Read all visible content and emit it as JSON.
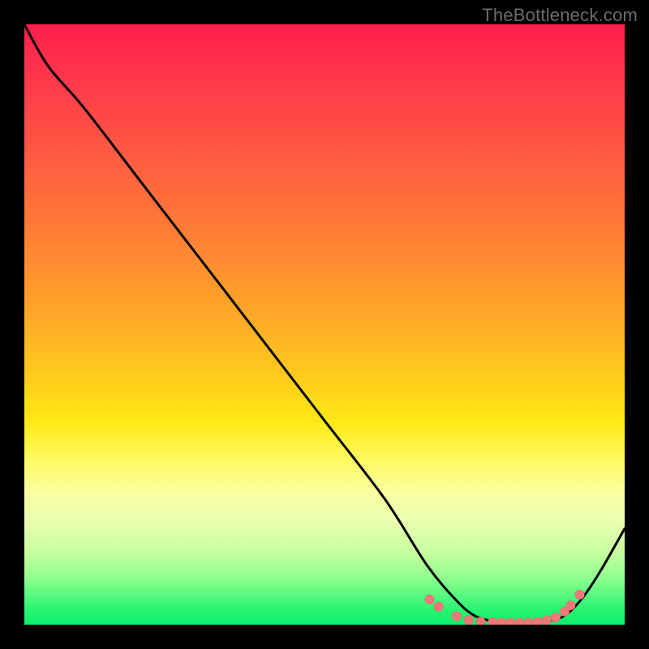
{
  "watermark": "TheBottleneck.com",
  "chart_data": {
    "type": "line",
    "title": "",
    "xlabel": "",
    "ylabel": "",
    "xlim": [
      0,
      100
    ],
    "ylim": [
      0,
      100
    ],
    "grid": false,
    "legend": false,
    "series": [
      {
        "name": "bottleneck-curve",
        "x": [
          0,
          4,
          10,
          20,
          30,
          40,
          50,
          60,
          67,
          72,
          75,
          78,
          81,
          84,
          87,
          90,
          93,
          96,
          100
        ],
        "y": [
          100,
          93,
          86,
          73,
          60,
          47,
          34,
          21,
          10,
          4,
          1.5,
          0.6,
          0.3,
          0.3,
          0.6,
          1.5,
          4.5,
          9,
          16
        ]
      }
    ],
    "highlight_points": {
      "name": "floor-dots",
      "x": [
        67.5,
        69,
        72,
        74,
        76,
        78,
        79.5,
        81,
        82.5,
        84,
        85.5,
        87,
        88.5,
        90,
        91,
        92.5
      ],
      "y": [
        4.2,
        3.0,
        1.4,
        0.8,
        0.5,
        0.4,
        0.35,
        0.3,
        0.3,
        0.35,
        0.45,
        0.7,
        1.2,
        2.2,
        3.2,
        5.0
      ]
    },
    "background": {
      "type": "vertical-gradient",
      "stops": [
        {
          "pos": 0,
          "color": "#ff1f4d"
        },
        {
          "pos": 50,
          "color": "#ffc81e"
        },
        {
          "pos": 80,
          "color": "#fbffa2"
        },
        {
          "pos": 100,
          "color": "#0ef06b"
        }
      ]
    }
  },
  "colors": {
    "curve": "#000000",
    "dots": "#f07878",
    "frame": "#000000",
    "watermark": "#6b6b6b"
  }
}
